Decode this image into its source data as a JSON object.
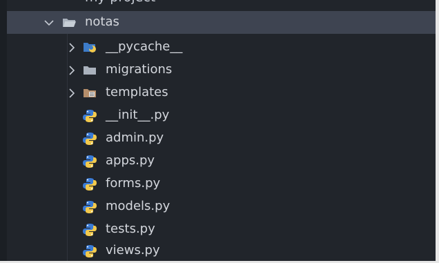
{
  "explorer": {
    "truncated_item": "my-project",
    "items": [
      {
        "label": "notas",
        "type": "folder-open",
        "expanded": true,
        "icon": "folder-open-icon"
      },
      {
        "label": "__pycache__",
        "type": "folder",
        "expanded": false,
        "icon": "python-folder-icon"
      },
      {
        "label": "migrations",
        "type": "folder",
        "expanded": false,
        "icon": "folder-icon"
      },
      {
        "label": "templates",
        "type": "folder",
        "expanded": false,
        "icon": "templates-folder-icon"
      },
      {
        "label": "__init__.py",
        "type": "file",
        "icon": "python-icon"
      },
      {
        "label": "admin.py",
        "type": "file",
        "icon": "python-icon"
      },
      {
        "label": "apps.py",
        "type": "file",
        "icon": "python-icon"
      },
      {
        "label": "forms.py",
        "type": "file",
        "icon": "python-icon"
      },
      {
        "label": "models.py",
        "type": "file",
        "icon": "python-icon"
      },
      {
        "label": "tests.py",
        "type": "file",
        "icon": "python-icon"
      },
      {
        "label": "views.py",
        "type": "file",
        "icon": "python-icon"
      }
    ]
  },
  "colors": {
    "background": "#21252b",
    "selected_row": "#3e4451",
    "text": "#d4d7dd",
    "folder": "#9aa3ad",
    "python_blue": "#3a7bd5",
    "python_yellow": "#f2c94c"
  }
}
